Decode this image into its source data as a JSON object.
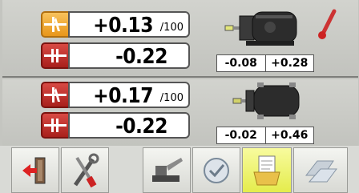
{
  "top": {
    "row1": {
      "value": "+0.13",
      "unit": "/100"
    },
    "row2": {
      "value": "-0.22"
    },
    "offsets": {
      "left": "-0.08",
      "right": "+0.28"
    }
  },
  "bottom": {
    "row1": {
      "value": "+0.17",
      "unit": "/100"
    },
    "row2": {
      "value": "-0.22"
    },
    "offsets": {
      "left": "-0.02",
      "right": "+0.46"
    }
  },
  "toolbar": {
    "buttons": [
      "exit-icon",
      "tools-icon",
      "machine-icon",
      "confirm-icon",
      "notes-icon",
      "shim-icon"
    ]
  },
  "colors": {
    "orange": "#e8961a",
    "red": "#a8201c",
    "active": "#e4ec4c"
  }
}
